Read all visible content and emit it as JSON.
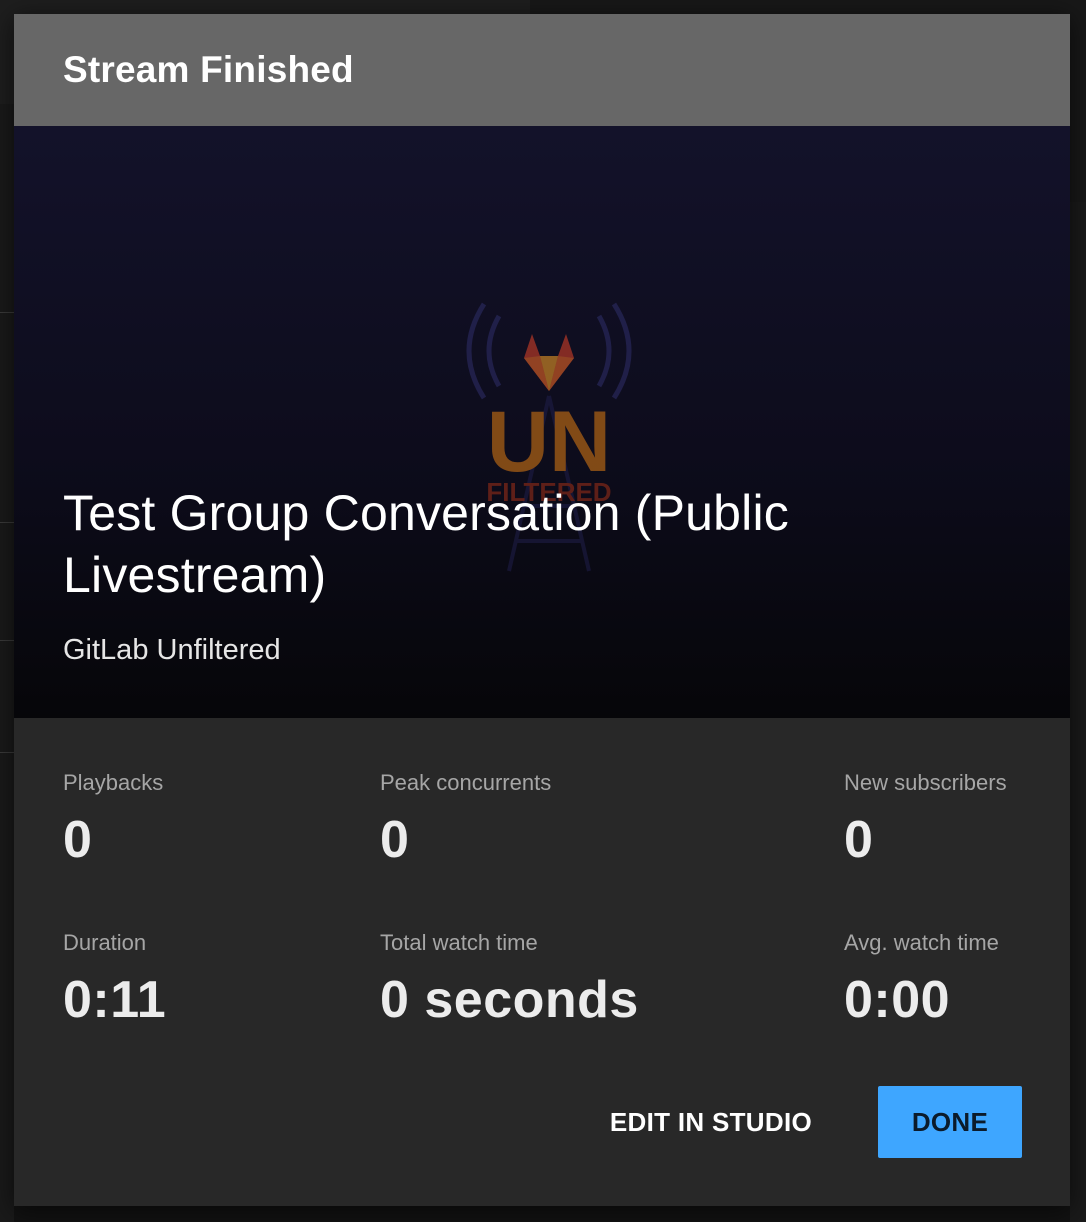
{
  "modal": {
    "title": "Stream Finished",
    "video": {
      "title": "Test Group Conversation (Public Livestream)",
      "channel": "GitLab Unfiltered",
      "thumbnail_logo": "gitlab-unfiltered-logo"
    },
    "stats": [
      {
        "label": "Playbacks",
        "value": "0"
      },
      {
        "label": "Peak concurrents",
        "value": "0"
      },
      {
        "label": "New subscribers",
        "value": "0"
      },
      {
        "label": "Duration",
        "value": "0:11"
      },
      {
        "label": "Total watch time",
        "value": "0 seconds"
      },
      {
        "label": "Avg. watch time",
        "value": "0:00"
      }
    ],
    "actions": {
      "edit_label": "EDIT IN STUDIO",
      "done_label": "DONE"
    }
  },
  "colors": {
    "header_bg": "#676767",
    "modal_bg": "#282828",
    "primary_button": "#3ea6ff"
  }
}
